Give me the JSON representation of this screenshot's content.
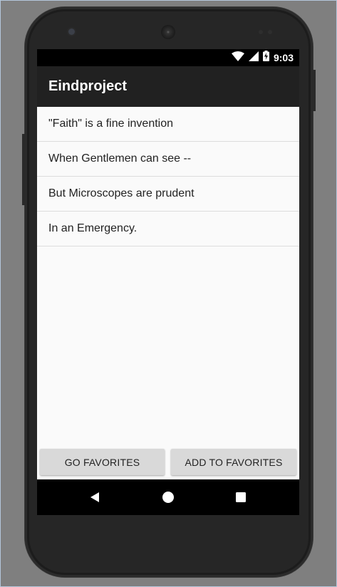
{
  "status_bar": {
    "time": "9:03",
    "icons": [
      "wifi-icon",
      "cell-signal-icon",
      "battery-charging-icon"
    ]
  },
  "app_bar": {
    "title": "Eindproject"
  },
  "list": {
    "items": [
      "\"Faith\" is a fine invention",
      "When Gentlemen can see --",
      "But Microscopes are prudent",
      "In an Emergency."
    ]
  },
  "buttons": {
    "go_favorites": "GO FAVORITES",
    "add_to_favorites": "ADD TO FAVORITES"
  },
  "nav_bar": {
    "icons": [
      "back-icon",
      "home-icon",
      "recents-icon"
    ]
  },
  "colors": {
    "app_bar": "#212121",
    "background": "#fafafa",
    "button": "#d9d9d9",
    "emulator_bg": "#7f7f7f"
  }
}
